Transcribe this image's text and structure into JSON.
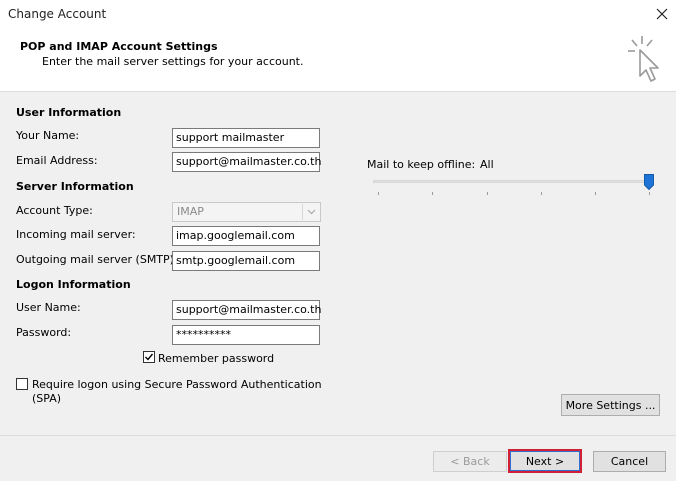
{
  "window": {
    "title": "Change Account",
    "close_icon": "close-icon"
  },
  "header": {
    "title": "POP and IMAP Account Settings",
    "subtitle": "Enter the mail server settings for your account."
  },
  "user_info": {
    "heading": "User Information",
    "your_name_label": "Your Name:",
    "your_name_value": "support mailmaster",
    "email_label": "Email Address:",
    "email_value": "support@mailmaster.co.th"
  },
  "server_info": {
    "heading": "Server Information",
    "account_type_label": "Account Type:",
    "account_type_value": "IMAP",
    "incoming_label": "Incoming mail server:",
    "incoming_value": "imap.googlemail.com",
    "outgoing_label": "Outgoing mail server (SMTP):",
    "outgoing_value": "smtp.googlemail.com"
  },
  "logon_info": {
    "heading": "Logon Information",
    "username_label": "User Name:",
    "username_value": "support@mailmaster.co.th",
    "password_label": "Password:",
    "password_value": "**********",
    "remember_label": "Remember password",
    "remember_checked": true,
    "spa_label_line1": "Require logon using Secure Password Authentication",
    "spa_label_line2": "(SPA)",
    "spa_checked": false
  },
  "offline": {
    "label": "Mail to keep offline:",
    "value": "All",
    "slider_fraction": 1.0
  },
  "buttons": {
    "more_settings": "More Settings ...",
    "back": "< Back",
    "next": "Next >",
    "cancel": "Cancel"
  },
  "colors": {
    "accent": "#1e73d6",
    "highlight_border": "#d11f35",
    "dialog_bg": "#f0f0f0"
  }
}
